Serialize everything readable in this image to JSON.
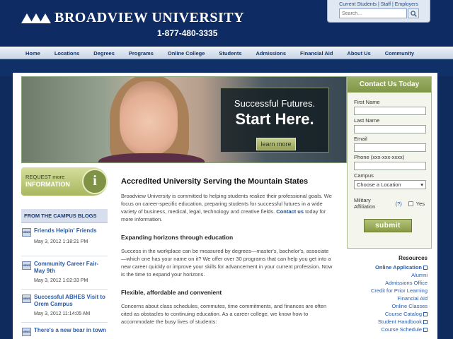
{
  "header": {
    "title": "Broadview University",
    "phone": "1-877-480-3335",
    "utility_links": [
      "Current Students",
      "Staff",
      "Employers"
    ],
    "search_placeholder": "Search..."
  },
  "nav": [
    "Home",
    "Locations",
    "Degrees",
    "Programs",
    "Online College",
    "Students",
    "Admissions",
    "Financial Aid",
    "About Us",
    "Community"
  ],
  "hero": {
    "line1": "Successful Futures.",
    "line2": "Start Here.",
    "button": "learn more"
  },
  "contact": {
    "title": "Contact Us Today",
    "fields": [
      "First Name",
      "Last Name",
      "Email",
      "Phone (xxx-xxx-xxxx)"
    ],
    "campus_label": "Campus",
    "campus_value": "Choose a Location",
    "military_label": "Military Affiliation",
    "military_help": "(?)",
    "military_option": "Yes",
    "submit": "submit"
  },
  "request": {
    "line1": "REQUEST more",
    "line2": "INFORMATION",
    "icon_letter": "i"
  },
  "blogs": {
    "title": "FROM THE CAMPUS BLOGS",
    "icon_label": "NEWS",
    "items": [
      {
        "title": "Friends Helpin' Friends",
        "date": "May 3, 2012 1:18:21 PM"
      },
      {
        "title": "Community Career Fair- May 9th",
        "date": "May 3, 2012 1:02:33 PM"
      },
      {
        "title": "Successful ABHES Visit to Orem Campus",
        "date": "May 3, 2012 11:14:05 AM"
      },
      {
        "title": "There's a new bear in town",
        "date": ""
      }
    ]
  },
  "article": {
    "title": "Accredited University Serving the Mountain States",
    "intro": "Broadview University is committed to helping students realize their professional goals. We focus on career-specific education, preparing students for successful futures in a wide variety of business, medical, legal, technology and creative fields.",
    "intro_link": "Contact us",
    "intro_end": "today for more information.",
    "h2": "Expanding horizons through education",
    "p2": "Success in the workplace can be measured by degrees—master's, bachelor's, associate—which one has your name on it? We offer over 30 programs that can help you get into a new career quickly or improve your skills for advancement in your current profession. Now is the time to expand your horizons.",
    "h3": "Flexible, affordable and convenient",
    "p3": "Concerns about class schedules, commutes, time commitments, and finances are often cited as obstacles to continuing education. As a career college, we know how to accommodate the busy lives of students:"
  },
  "resources": {
    "title": "Resources",
    "items": [
      {
        "label": "Online Application",
        "external": true,
        "bold": true
      },
      {
        "label": "Alumni",
        "external": false,
        "bold": false
      },
      {
        "label": "Admissions Office",
        "external": false,
        "bold": false
      },
      {
        "label": "Credit for Prior Learning",
        "external": false,
        "bold": false
      },
      {
        "label": "Financial Aid",
        "external": false,
        "bold": false
      },
      {
        "label": "Online Classes",
        "external": false,
        "bold": false
      },
      {
        "label": "Course Catalog",
        "external": true,
        "bold": false
      },
      {
        "label": "Student Handbook",
        "external": true,
        "bold": false
      },
      {
        "label": "Course Schedule",
        "external": true,
        "bold": false
      }
    ]
  }
}
